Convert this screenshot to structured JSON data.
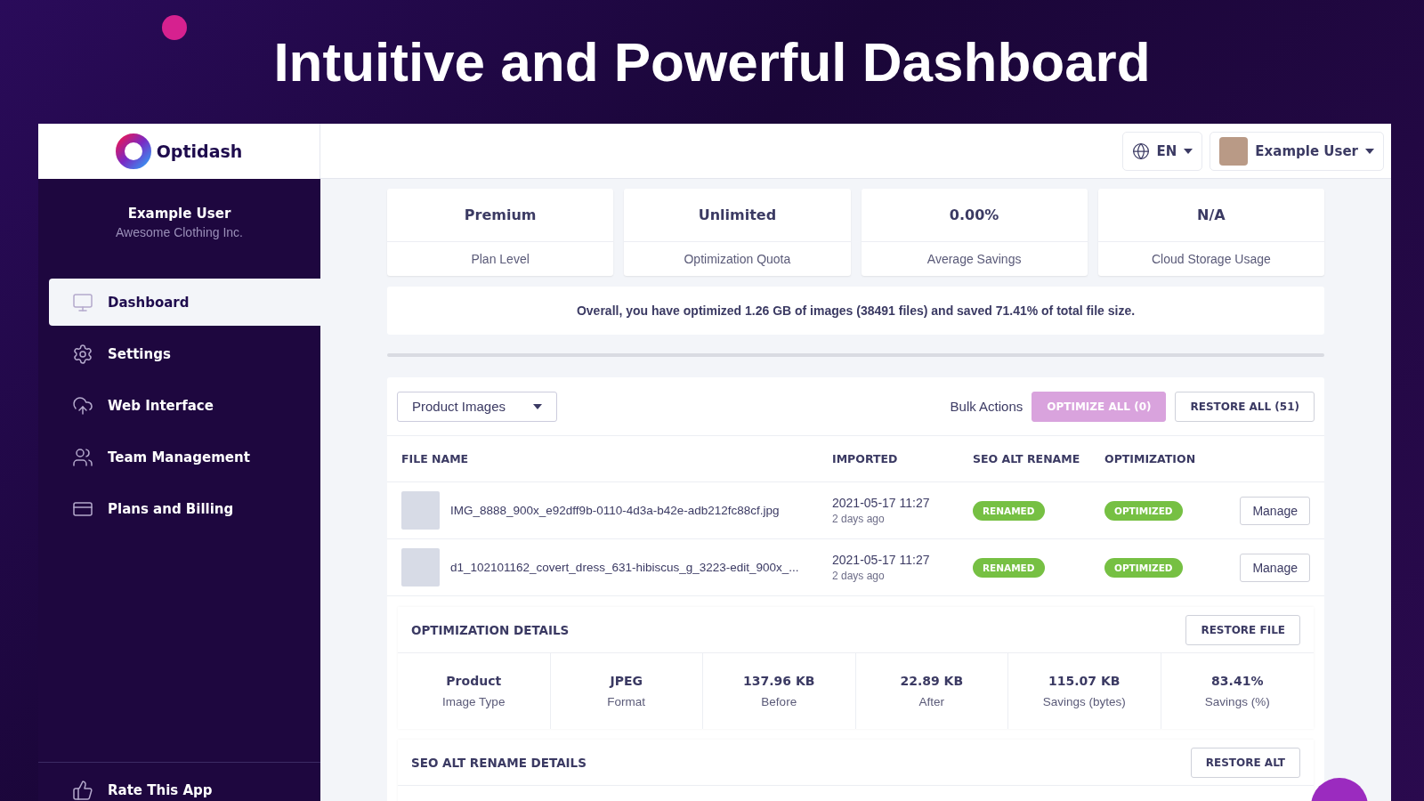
{
  "banner": {
    "title": "Intuitive and Powerful Dashboard"
  },
  "brand": {
    "name": "Optidash"
  },
  "header": {
    "language": "EN",
    "user": "Example User"
  },
  "sidebar": {
    "user_name": "Example User",
    "company": "Awesome Clothing Inc.",
    "items": [
      {
        "label": "Dashboard",
        "kind": "monitor",
        "selected": true
      },
      {
        "label": "Settings",
        "kind": "gear",
        "selected": false
      },
      {
        "label": "Web Interface",
        "kind": "upload",
        "selected": false
      },
      {
        "label": "Team Management",
        "kind": "users",
        "selected": false
      },
      {
        "label": "Plans and Billing",
        "kind": "card",
        "selected": false
      }
    ],
    "footer_item": {
      "label": "Rate This App"
    }
  },
  "stats": [
    {
      "value": "Premium",
      "label": "Plan Level"
    },
    {
      "value": "Unlimited",
      "label": "Optimization Quota"
    },
    {
      "value": "0.00%",
      "label": "Average Savings"
    },
    {
      "value": "N/A",
      "label": "Cloud Storage Usage"
    }
  ],
  "summary": "Overall, you have optimized 1.26 GB of images (38491 files) and saved 71.41% of total file size.",
  "file_filter": "Product Images",
  "bulk_actions": {
    "label": "Bulk Actions",
    "buttons": [
      {
        "label": "OPTIMIZE ALL (0)",
        "disabled": true
      },
      {
        "label": "RESTORE ALL (51)",
        "disabled": false
      }
    ]
  },
  "table": {
    "columns": [
      "FILE NAME",
      "IMPORTED",
      "SEO ALT RENAME",
      "OPTIMIZATION"
    ],
    "rows": [
      {
        "file_name": "IMG_8888_900x_e92dff9b-0110-4d3a-b42e-adb212fc88cf.jpg",
        "imported": "2021-05-17 11:27",
        "imported_ago": "2 days ago",
        "seo_status": "RENAMED",
        "optimization_status": "OPTIMIZED",
        "action": "Manage"
      },
      {
        "file_name": "d1_102101162_covert_dress_631-hibiscus_g_3223-edit_900x_...",
        "imported": "2021-05-17 11:27",
        "imported_ago": "2 days ago",
        "seo_status": "RENAMED",
        "optimization_status": "OPTIMIZED",
        "action": "Manage"
      }
    ]
  },
  "optimization_details": {
    "title": "OPTIMIZATION DETAILS",
    "action": "RESTORE FILE",
    "stats": [
      {
        "value": "Product",
        "label": "Image Type"
      },
      {
        "value": "JPEG",
        "label": "Format"
      },
      {
        "value": "137.96 KB",
        "label": "Before"
      },
      {
        "value": "22.89 KB",
        "label": "After"
      },
      {
        "value": "115.07 KB",
        "label": "Savings (bytes)"
      },
      {
        "value": "83.41%",
        "label": "Savings (%)"
      }
    ]
  },
  "seo_details": {
    "title": "SEO ALT RENAME DETAILS",
    "action": "RESTORE ALT"
  }
}
